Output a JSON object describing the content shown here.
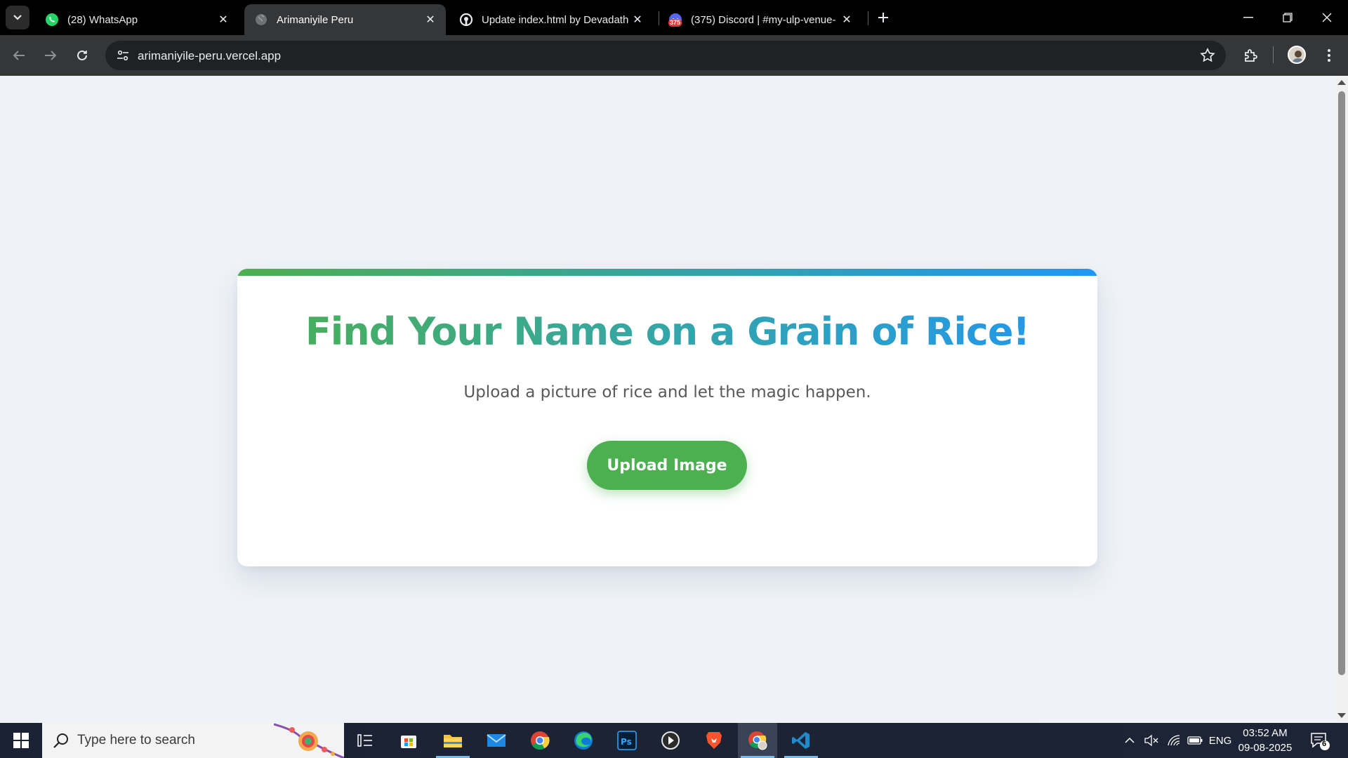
{
  "browser": {
    "tabs": [
      {
        "title": "(28) WhatsApp",
        "favicon": "whatsapp-icon",
        "active": false
      },
      {
        "title": "Arimaniyile Peru",
        "favicon": "globe-icon",
        "active": true
      },
      {
        "title": "Update index.html by Devadath",
        "favicon": "github-icon",
        "active": false
      },
      {
        "title": "(375) Discord | #my-ulp-venue-",
        "favicon": "discord-icon",
        "active": false,
        "badge": "375"
      }
    ],
    "address": "arimaniyile-peru.vercel.app"
  },
  "page": {
    "title": "Find Your Name on a Grain of Rice!",
    "subtitle": "Upload a picture of rice and let the magic happen.",
    "upload_button": "Upload Image",
    "colors": {
      "green": "#4caf50",
      "blue": "#2196f3",
      "background": "#eff3f8"
    }
  },
  "taskbar": {
    "search_placeholder": "Type here to search",
    "language": "ENG",
    "time": "03:52 AM",
    "date": "09-08-2025",
    "notification_count": "6"
  }
}
